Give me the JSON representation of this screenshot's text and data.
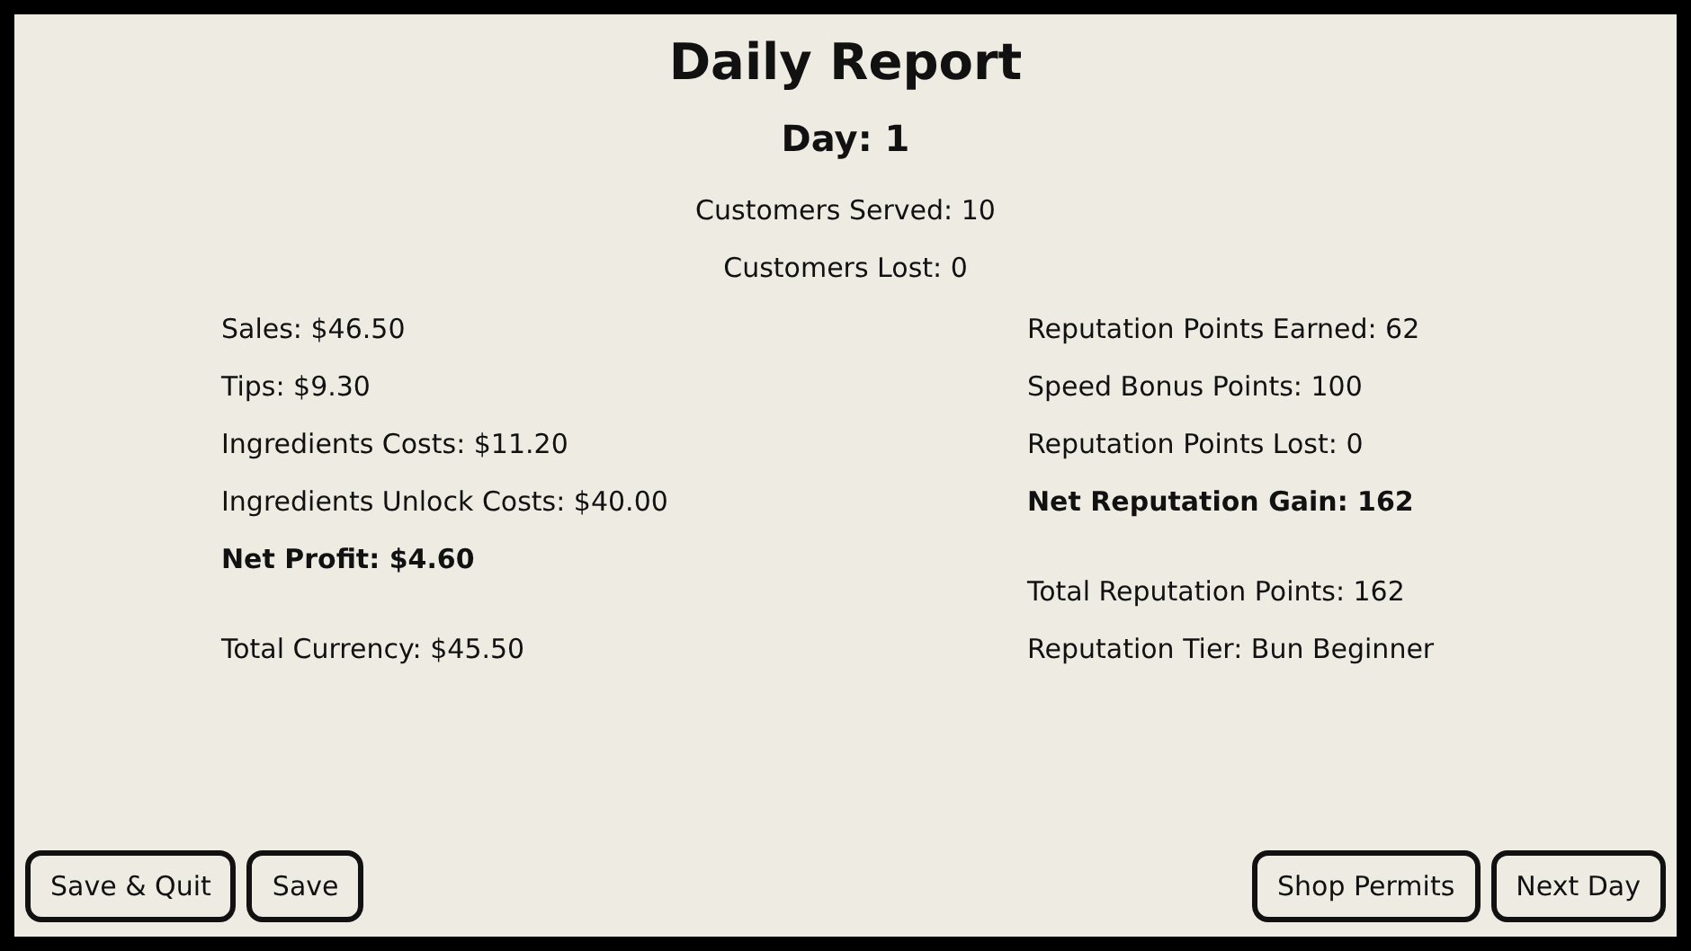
{
  "title": "Daily Report",
  "day": "Day: 1",
  "summary": [
    "Customers Served: 10",
    "Customers Lost: 0"
  ],
  "left_column": [
    {
      "lines": [
        {
          "text": "Sales: $46.50",
          "bold": false
        },
        {
          "text": "Tips: $9.30",
          "bold": false
        },
        {
          "text": "Ingredients Costs: $11.20",
          "bold": false
        },
        {
          "text": "Ingredients Unlock Costs: $40.00",
          "bold": false
        },
        {
          "text": "Net Profit: $4.60",
          "bold": true
        }
      ]
    },
    {
      "lines": [
        {
          "text": "Total Currency: $45.50",
          "bold": false
        }
      ]
    }
  ],
  "right_column": [
    {
      "lines": [
        {
          "text": "Reputation Points Earned: 62",
          "bold": false
        },
        {
          "text": "Speed Bonus Points: 100",
          "bold": false
        },
        {
          "text": "Reputation Points Lost: 0",
          "bold": false
        },
        {
          "text": "Net Reputation Gain: 162",
          "bold": true
        }
      ]
    },
    {
      "lines": [
        {
          "text": "Total Reputation Points: 162",
          "bold": false
        },
        {
          "text": "Reputation Tier: Bun Beginner",
          "bold": false
        }
      ]
    }
  ],
  "buttons_left": [
    "Save & Quit",
    "Save"
  ],
  "buttons_right": [
    "Shop Permits",
    "Next Day"
  ]
}
